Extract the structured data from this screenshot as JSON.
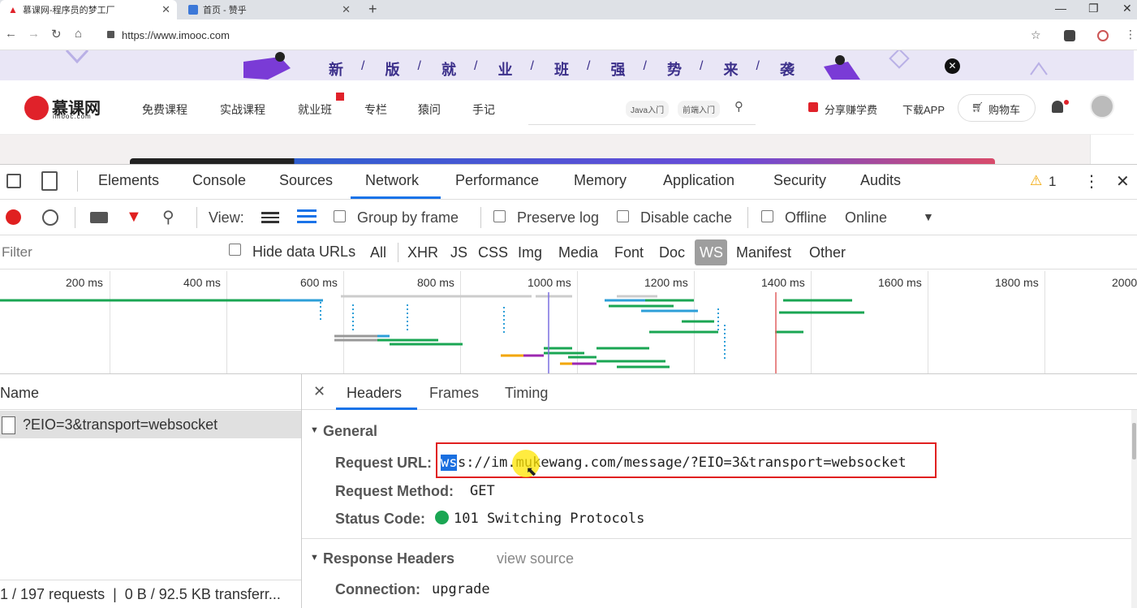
{
  "browser": {
    "tabs": [
      {
        "title": "慕课网-程序员的梦工厂",
        "active": true
      },
      {
        "title": "首页 - 赞乎",
        "active": false
      }
    ],
    "url": "https://www.imooc.com"
  },
  "site": {
    "banner_chars": [
      "新",
      "版",
      "就",
      "业",
      "班",
      "强",
      "势",
      "来",
      "袭"
    ],
    "logo_main": "慕课网",
    "logo_sub": "imooc.com",
    "nav": [
      "免费课程",
      "实战课程",
      "就业班",
      "专栏",
      "猿问",
      "手记"
    ],
    "search_tags": [
      "Java入门",
      "前端入门"
    ],
    "right_links": [
      "分享赚学费",
      "下载APP",
      "购物车"
    ]
  },
  "devtools": {
    "tabs": [
      "Elements",
      "Console",
      "Sources",
      "Network",
      "Performance",
      "Memory",
      "Application",
      "Security",
      "Audits"
    ],
    "active_tab": "Network",
    "warning_count": "1",
    "toolbar": {
      "view_label": "View:",
      "group_by_frame": "Group by frame",
      "preserve_log": "Preserve log",
      "disable_cache": "Disable cache",
      "offline": "Offline",
      "online": "Online"
    },
    "filter": {
      "placeholder": "Filter",
      "hide_data_urls": "Hide data URLs",
      "types": [
        "All",
        "XHR",
        "JS",
        "CSS",
        "Img",
        "Media",
        "Font",
        "Doc",
        "WS",
        "Manifest",
        "Other"
      ],
      "active_type": "WS"
    },
    "timeline_ticks": [
      "200 ms",
      "400 ms",
      "600 ms",
      "800 ms",
      "1000 ms",
      "1200 ms",
      "1400 ms",
      "1600 ms",
      "1800 ms",
      "2000"
    ],
    "name_column": {
      "header": "Name",
      "rows": [
        "?EIO=3&transport=websocket"
      ],
      "status": "1 / 197 requests  |  0 B / 92.5 KB transferr..."
    },
    "detail": {
      "tabs": [
        "Headers",
        "Frames",
        "Timing"
      ],
      "active_tab": "Headers",
      "general_title": "General",
      "request_url_label": "Request URL:",
      "request_url_sel": "ws",
      "request_url_rest": "s://im.mukewang.com/message/?EIO=3&transport=websocket",
      "request_method_label": "Request Method:",
      "request_method": "GET",
      "status_code_label": "Status Code:",
      "status_code": "101 Switching Protocols",
      "response_headers_title": "Response Headers",
      "view_source": "view source",
      "connection_label": "Connection:",
      "connection_value": "upgrade"
    }
  }
}
